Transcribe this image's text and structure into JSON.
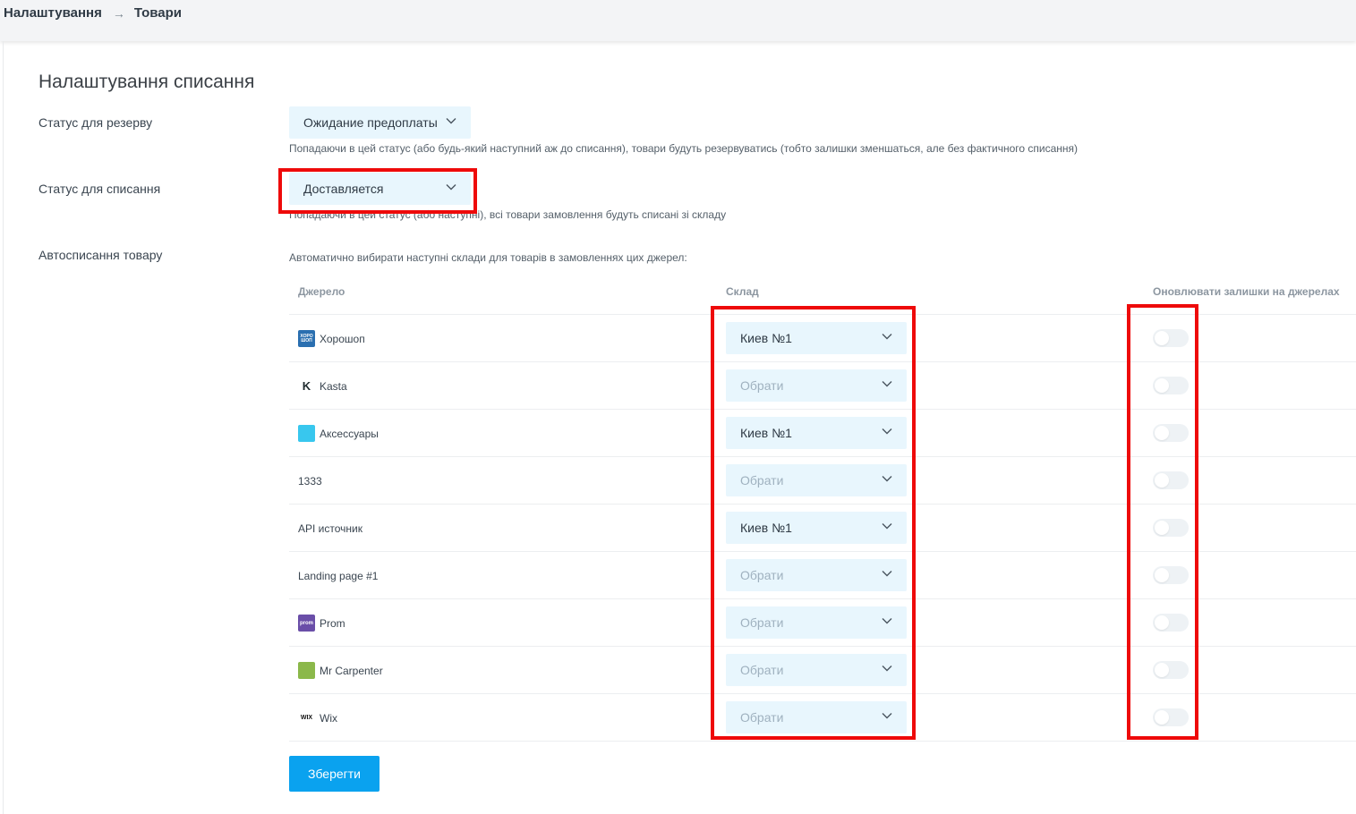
{
  "breadcrumb": {
    "parent": "Налаштування",
    "arrow": "→",
    "current": "Товари"
  },
  "page": {
    "title": "Налаштування списання"
  },
  "reserve": {
    "label": "Статус для резерву",
    "value": "Ожидание предоплаты",
    "hint": "Попадаючи в цей статус (або будь-який наступний аж до списання), товари будуть резервуватись (тобто залишки зменшаться, але без фактичного списання)"
  },
  "writeoff": {
    "label": "Статус для списання",
    "value": "Доставляется",
    "hint": "Попадаючи в цей статус (або наступні), всі товари замовлення будуть списані зі складу"
  },
  "auto": {
    "label": "Автосписання товару",
    "hint": "Автоматично вибирати наступні склади для товарів в замовленнях цих джерел:"
  },
  "table": {
    "columns": {
      "source": "Джерело",
      "warehouse": "Склад",
      "update": "Оновлювати залишки на джерелах"
    },
    "rows": [
      {
        "source": "Хорошоп",
        "icon": "horoshop-icon",
        "icon_text": "ХОРО ШОП",
        "icon_color": "#2a6fb0",
        "warehouse": "Киев №1",
        "selected": true,
        "update": false
      },
      {
        "source": "Kasta",
        "icon": "kasta-icon",
        "icon_text": "K",
        "icon_color": "#1f2b2e",
        "warehouse": "Обрати",
        "selected": false,
        "update": false
      },
      {
        "source": "Аксессуары",
        "icon": "cart-icon",
        "icon_text": "",
        "icon_color": "#38c7ee",
        "warehouse": "Киев №1",
        "selected": true,
        "update": false
      },
      {
        "source": "1333",
        "icon": "",
        "icon_text": "",
        "icon_color": "",
        "warehouse": "Обрати",
        "selected": false,
        "update": false
      },
      {
        "source": "API источник",
        "icon": "",
        "icon_text": "",
        "icon_color": "",
        "warehouse": "Киев №1",
        "selected": true,
        "update": false
      },
      {
        "source": "Landing page #1",
        "icon": "",
        "icon_text": "",
        "icon_color": "",
        "warehouse": "Обрати",
        "selected": false,
        "update": false
      },
      {
        "source": "Prom",
        "icon": "prom-icon",
        "icon_text": "prom",
        "icon_color": "#6a4ea8",
        "warehouse": "Обрати",
        "selected": false,
        "update": false
      },
      {
        "source": "Mr Carpenter",
        "icon": "shopify-icon",
        "icon_text": "",
        "icon_color": "#8bb84a",
        "warehouse": "Обрати",
        "selected": false,
        "update": false
      },
      {
        "source": "Wix",
        "icon": "wix-icon",
        "icon_text": "WIX",
        "icon_color": "#111111",
        "warehouse": "Обрати",
        "selected": false,
        "update": false
      }
    ]
  },
  "actions": {
    "save": "Зберегти"
  },
  "colors": {
    "accent": "#0aa2ef",
    "select_bg": "#e8f6fd",
    "highlight": "#ee0a0a"
  }
}
